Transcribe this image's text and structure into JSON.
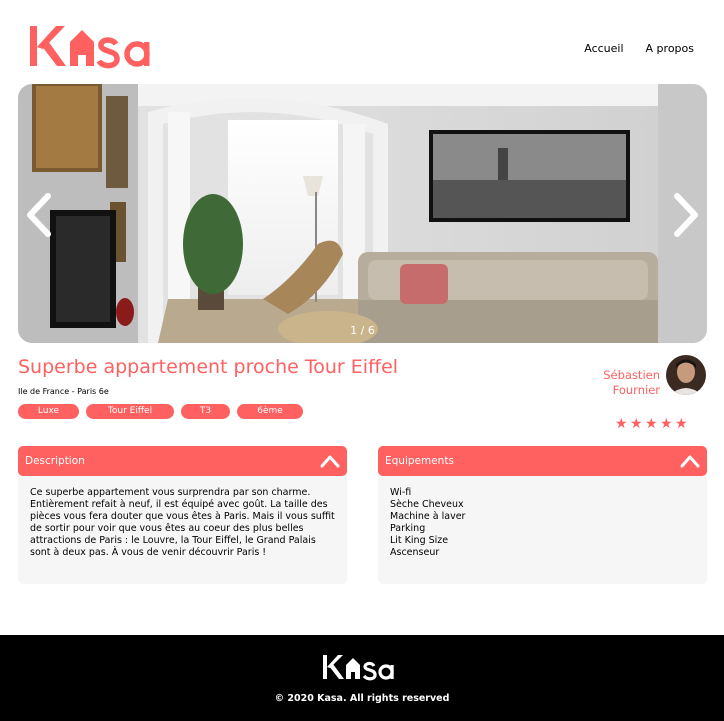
{
  "brand": {
    "logo_text": "Kasa",
    "accent_color": "#ff6060"
  },
  "nav": {
    "home": "Accueil",
    "about": "A propos"
  },
  "gallery": {
    "counter": "1 / 6",
    "prev_icon": "chevron-left-icon",
    "next_icon": "chevron-right-icon"
  },
  "listing": {
    "title": "Superbe appartement proche Tour Eiffel",
    "location": "Ile de France - Paris 6e",
    "tags": [
      "Luxe",
      "Tour Eiffel",
      "T3",
      "6ème"
    ]
  },
  "host": {
    "first_name": "Sébastien",
    "last_name": "Fournier"
  },
  "rating": {
    "value": 5,
    "max": 5
  },
  "description": {
    "label": "Description",
    "text": "Ce superbe appartement vous surprendra par son charme. Entièrement refait à neuf, il est équipé avec goût. La taille des pièces vous fera douter que vous êtes à Paris. Mais il vous suffit de sortir pour voir que vous êtes au coeur des plus belles attractions de Paris : le Louvre, la Tour Eiffel, le Grand Palais sont à deux pas. À vous de venir découvrir Paris !"
  },
  "equipments": {
    "label": "Equipements",
    "items": [
      "Wi-fi",
      "Sèche Cheveux",
      "Machine à laver",
      "Parking",
      "Lit King Size",
      "Ascenseur"
    ]
  },
  "footer": {
    "copyright": "© 2020 Kasa. All rights reserved"
  }
}
